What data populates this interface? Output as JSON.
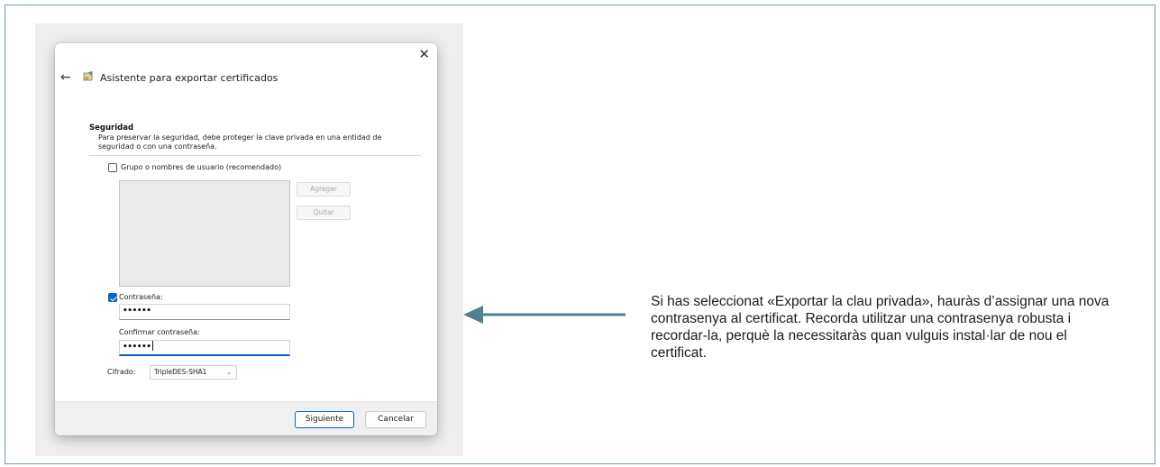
{
  "wizard": {
    "title": "Asistente para exportar certificados",
    "close_icon": "close-icon",
    "back_icon": "back-arrow-icon",
    "wizard_icon": "certificate-wizard-icon"
  },
  "security": {
    "heading": "Seguridad",
    "description": "Para preservar la seguridad, debe proteger la clave privada en una entidad de seguridad o con una contraseña."
  },
  "group_option": {
    "label": "Grupo o nombres de usuario (recomendado)",
    "checked": false
  },
  "group_buttons": {
    "add": "Agregar",
    "remove": "Quitar"
  },
  "password_option": {
    "label": "Contraseña:",
    "checked": true,
    "value": "••••••"
  },
  "confirm_password": {
    "label": "Confirmar contraseña:",
    "value": "••••••"
  },
  "encryption": {
    "label": "Cifrado:",
    "selected": "TripleDES-SHA1"
  },
  "footer": {
    "next": "Siguiente",
    "cancel": "Cancelar"
  },
  "annotation": {
    "text": "Si has seleccionat «Exportar la clau privada», hauràs d’assignar una nova contrasenya al certificat. Recorda utilitzar una contrasenya robusta i recordar-la, perquè la necessitaràs quan vulguis instal·lar de nou el certificat.",
    "arrow_color": "#4f8193"
  },
  "colors": {
    "frame_border": "#6f9bad",
    "accent": "#0b61c8"
  }
}
